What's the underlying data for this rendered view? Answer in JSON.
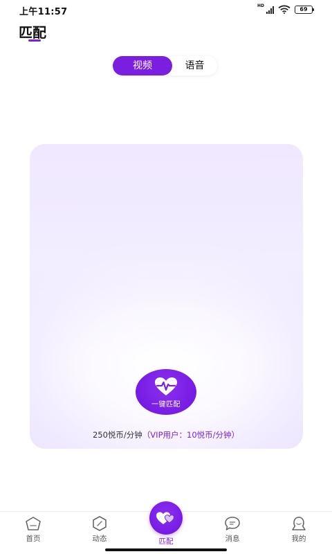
{
  "status_bar": {
    "time": "上午11:57",
    "network_label": "HD",
    "battery": "69",
    "icons": [
      "signal-icon",
      "wifi-icon",
      "battery-icon"
    ]
  },
  "header": {
    "title": "匹配"
  },
  "mode_toggle": {
    "tabs": [
      {
        "label": "视频",
        "active": true
      },
      {
        "label": "语音",
        "active": false
      }
    ]
  },
  "match_card": {
    "button_label": "一键匹配",
    "button_icon": "heart-pulse-icon",
    "price_text": "250悦币/分钟",
    "vip_text": "（VIP用户：10悦币/分钟）"
  },
  "bottom_nav": {
    "items": [
      {
        "label": "首页",
        "icon": "home-icon",
        "active": false
      },
      {
        "label": "动态",
        "icon": "compass-icon",
        "active": false
      },
      {
        "label": "匹配",
        "icon": "hearts-icon",
        "active": true
      },
      {
        "label": "消息",
        "icon": "chat-icon",
        "active": false
      },
      {
        "label": "我的",
        "icon": "profile-icon",
        "active": false
      }
    ]
  },
  "colors": {
    "accent": "#7a1fe0",
    "card_tint": "#ede6ff"
  }
}
